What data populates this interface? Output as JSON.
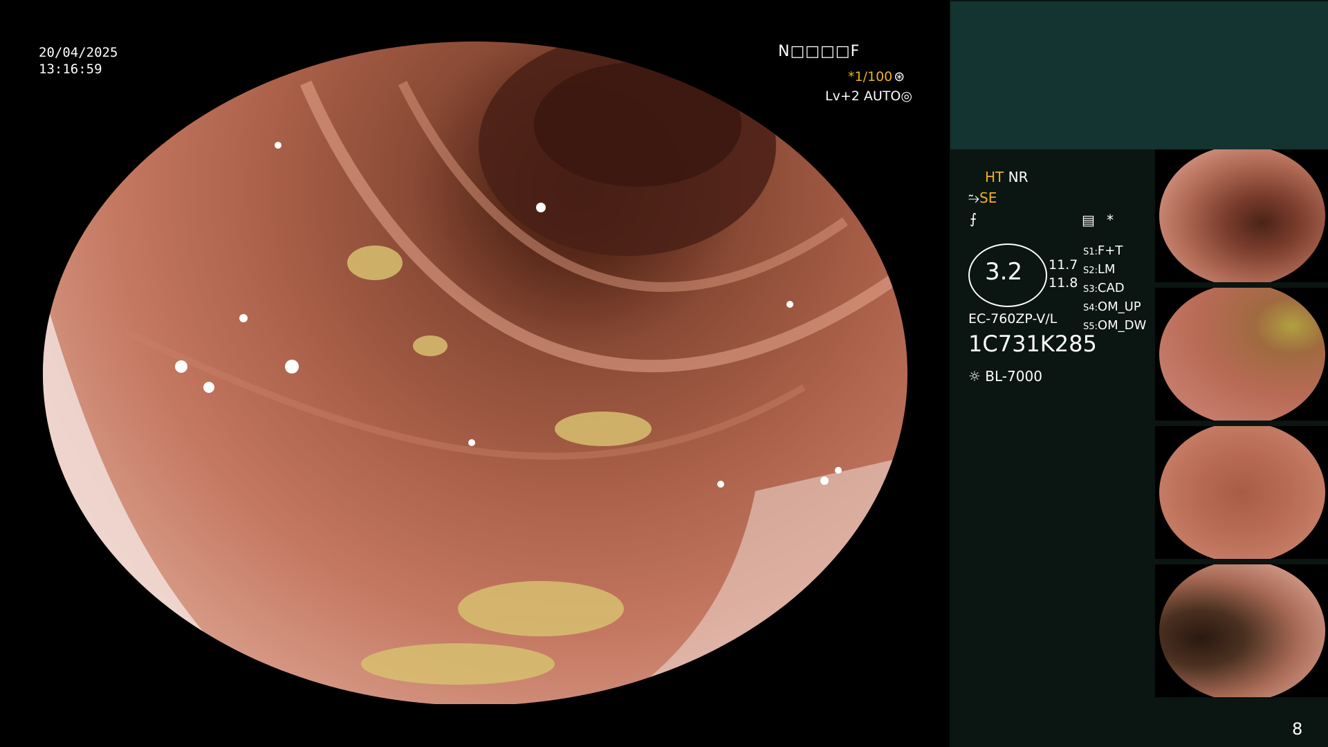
{
  "overlay": {
    "date": "20/04/2025",
    "time": "13:16:59",
    "patient_id": "N□□□□F",
    "ratio": "*1/100",
    "level": "Lv+2",
    "mode": "AUTO"
  },
  "panel": {
    "ht": "HT",
    "nr": "NR",
    "se": "SE",
    "scope_value": "3.2",
    "val_a": "11.7",
    "val_b": "11.8",
    "model": "EC-760ZP-V/L",
    "serial": "1C731K285",
    "light": "BL-7000",
    "star": "*",
    "settings": [
      {
        "key": "S1:",
        "value": "F+T"
      },
      {
        "key": "S2:",
        "value": "LM"
      },
      {
        "key": "S3:",
        "value": "CAD"
      },
      {
        "key": "S4:",
        "value": "OM_UP"
      },
      {
        "key": "S5:",
        "value": "OM_DW"
      }
    ]
  },
  "thumbnails": [
    {
      "label": "thumbnail-1"
    },
    {
      "label": "thumbnail-2"
    },
    {
      "label": "thumbnail-3"
    },
    {
      "label": "thumbnail-4"
    }
  ],
  "page_number": "8",
  "colors": {
    "amber": "#f0b020",
    "panel_bg": "#0b1512",
    "panel_top": "#133430"
  }
}
